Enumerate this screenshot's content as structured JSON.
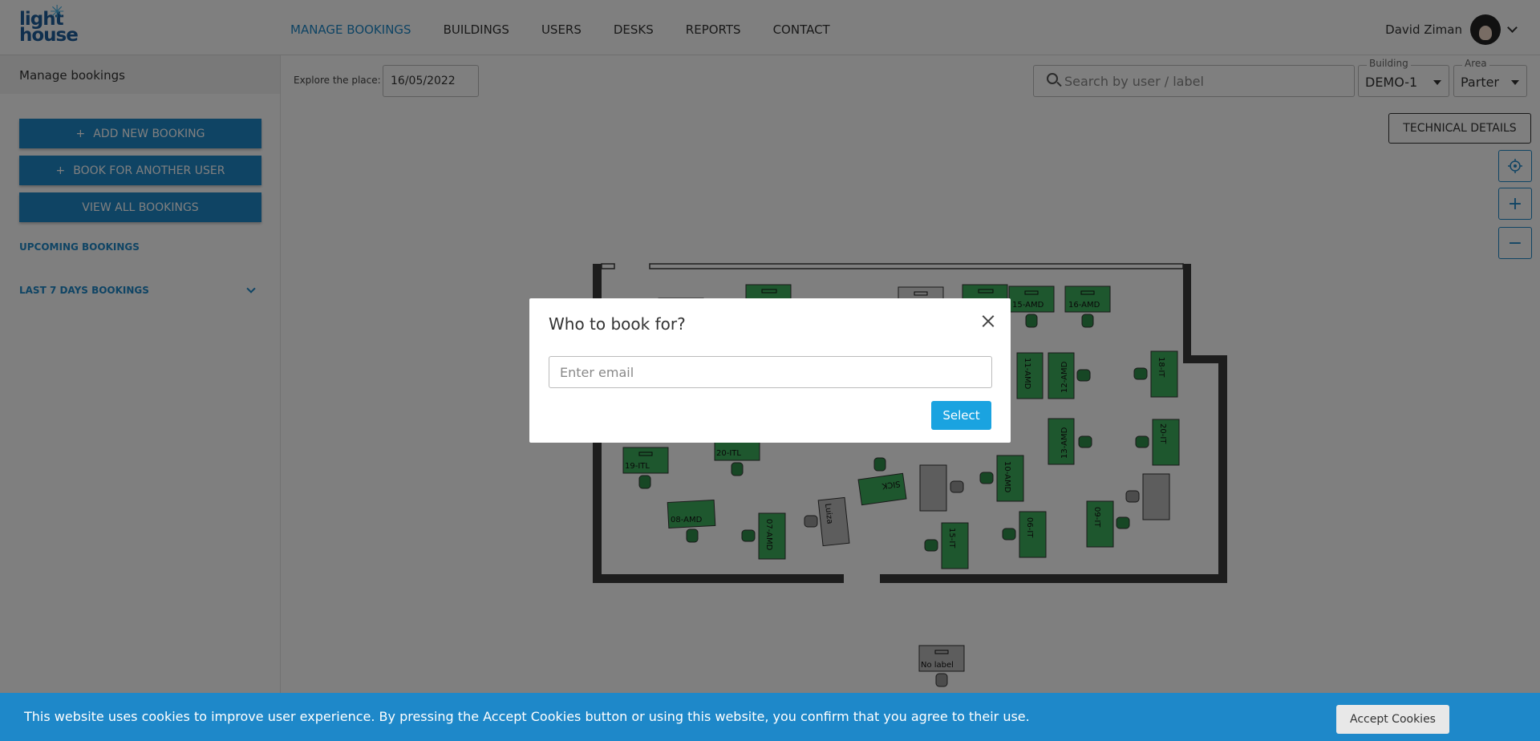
{
  "header": {
    "logo_line1": "light",
    "logo_line2": "house",
    "nav": [
      "MANAGE BOOKINGS",
      "BUILDINGS",
      "USERS",
      "DESKS",
      "REPORTS",
      "CONTACT"
    ],
    "user_name": "David Ziman"
  },
  "sidebar": {
    "title": "Manage bookings",
    "add_new_booking": "ADD NEW BOOKING",
    "book_for_another": "BOOK FOR ANOTHER USER",
    "view_all": "VIEW ALL BOOKINGS",
    "upcoming": "UPCOMING BOOKINGS",
    "last7": "LAST 7 DAYS BOOKINGS"
  },
  "toolbar": {
    "explore_label": "Explore the place:",
    "date": "16/05/2022",
    "search_placeholder": "Search by user / label",
    "building_label": "Building",
    "building_value": "DEMO-1",
    "area_label": "Area",
    "area_value": "Parter",
    "tech_details": "TECHNICAL DETAILS"
  },
  "map_controls": {
    "locate_icon": "target-icon",
    "zoom_in": "+",
    "zoom_out": "−"
  },
  "desks": {
    "d15": "15-AMD",
    "d16": "16-AMD",
    "d11": "11-AMD",
    "d12": "12-AMD",
    "d18": "18-IT",
    "d13": "13-AMD",
    "d20": "20-IT",
    "d19": "19-ITL",
    "d20b": "20-ITL",
    "d10": "10-AMD",
    "d08": "08-AMD",
    "d07": "07-AMD",
    "dlo": "Luiza",
    "dsick": "SICK",
    "d15it": "15-IT",
    "d06": "06-IT",
    "d09": "09-IT",
    "nolabel": "No label"
  },
  "modal": {
    "title": "Who to book for?",
    "email_placeholder": "Enter email",
    "select": "Select"
  },
  "cookie": {
    "text": "This website uses cookies to improve user experience. By pressing the Accept Cookies button or using this website, you confirm that you agree to their use.",
    "button": "Accept Cookies"
  },
  "colors": {
    "primary": "#1e88c9",
    "select_button": "#1aa3e0",
    "desk_green": "#3dae5c",
    "wall": "#3a3a3a"
  }
}
